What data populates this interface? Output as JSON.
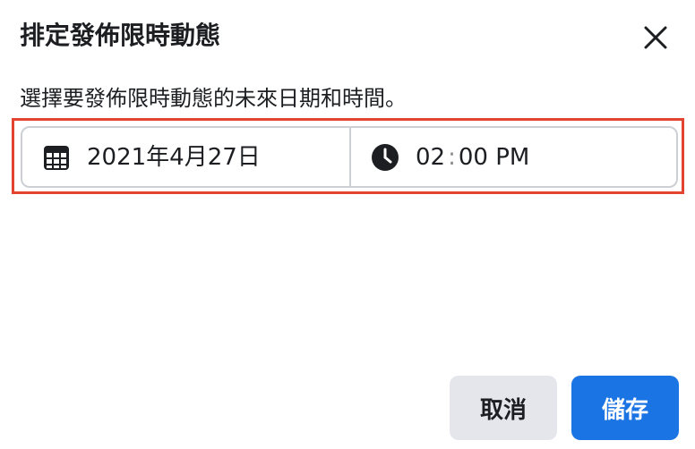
{
  "dialog": {
    "title": "排定發佈限時動態",
    "description": "選擇要發佈限時動態的未來日期和時間。"
  },
  "schedule": {
    "date_value": "2021年4月27日",
    "time_hour": "02",
    "time_separator": ":",
    "time_rest": "00 PM"
  },
  "icons": {
    "close": "close-icon",
    "date": "calendar-icon",
    "time": "clock-icon"
  },
  "buttons": {
    "cancel_label": "取消",
    "save_label": "儲存"
  },
  "colors": {
    "primary": "#1b74e4",
    "secondary_button": "#e4e6eb",
    "highlight_border": "#e2442f",
    "text": "#1c1e21"
  }
}
